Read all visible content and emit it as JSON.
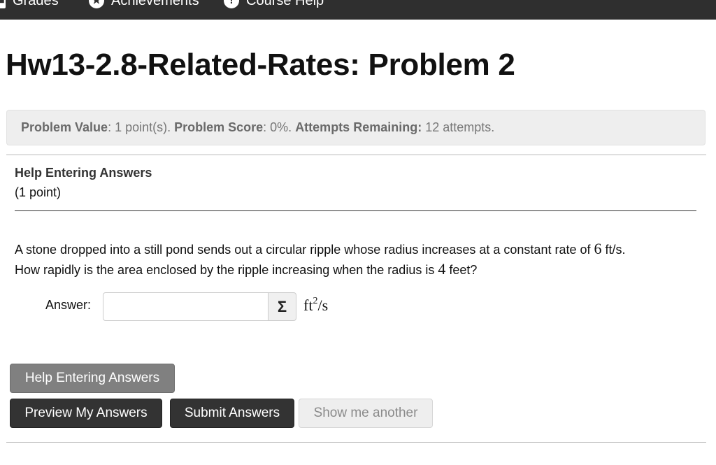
{
  "topnav": {
    "items": [
      {
        "label": "Grades",
        "icon": "grades-icon"
      },
      {
        "label": "Achievements",
        "icon": "achievements-icon"
      },
      {
        "label": "Course Help",
        "icon": "help-icon"
      }
    ]
  },
  "page": {
    "title": "Hw13-2.8-Related-Rates: Problem 2"
  },
  "info": {
    "value_label": "Problem Value",
    "value_text": ": 1 point(s). ",
    "score_label": "Problem Score",
    "score_text": ": 0%. ",
    "attempts_label": "Attempts Remaining:",
    "attempts_text": " 12 attempts."
  },
  "problem": {
    "help_title": "Help Entering Answers",
    "points": "(1 point)",
    "text_part1": "A stone dropped into a still pond sends out a circular ripple whose radius increases at a constant rate of ",
    "rate_value": "6",
    "text_part2": " ft/s.",
    "text_part3": "How rapidly is the area enclosed by the ripple increasing when the radius is ",
    "radius_value": "4",
    "text_part4": " feet?",
    "answer_label": "Answer:",
    "answer_value": "",
    "equation_button": "Σ",
    "unit_base": "ft",
    "unit_exp": "2",
    "unit_tail": "/s"
  },
  "buttons": {
    "help": "Help Entering Answers",
    "preview": "Preview My Answers",
    "submit": "Submit Answers",
    "another": "Show me another"
  },
  "colors": {
    "topbar": "#2f2f2f",
    "dark_button": "#333333",
    "help_button": "#808080",
    "disabled_button": "#eeeeee",
    "info_box": "#eeeeee"
  }
}
